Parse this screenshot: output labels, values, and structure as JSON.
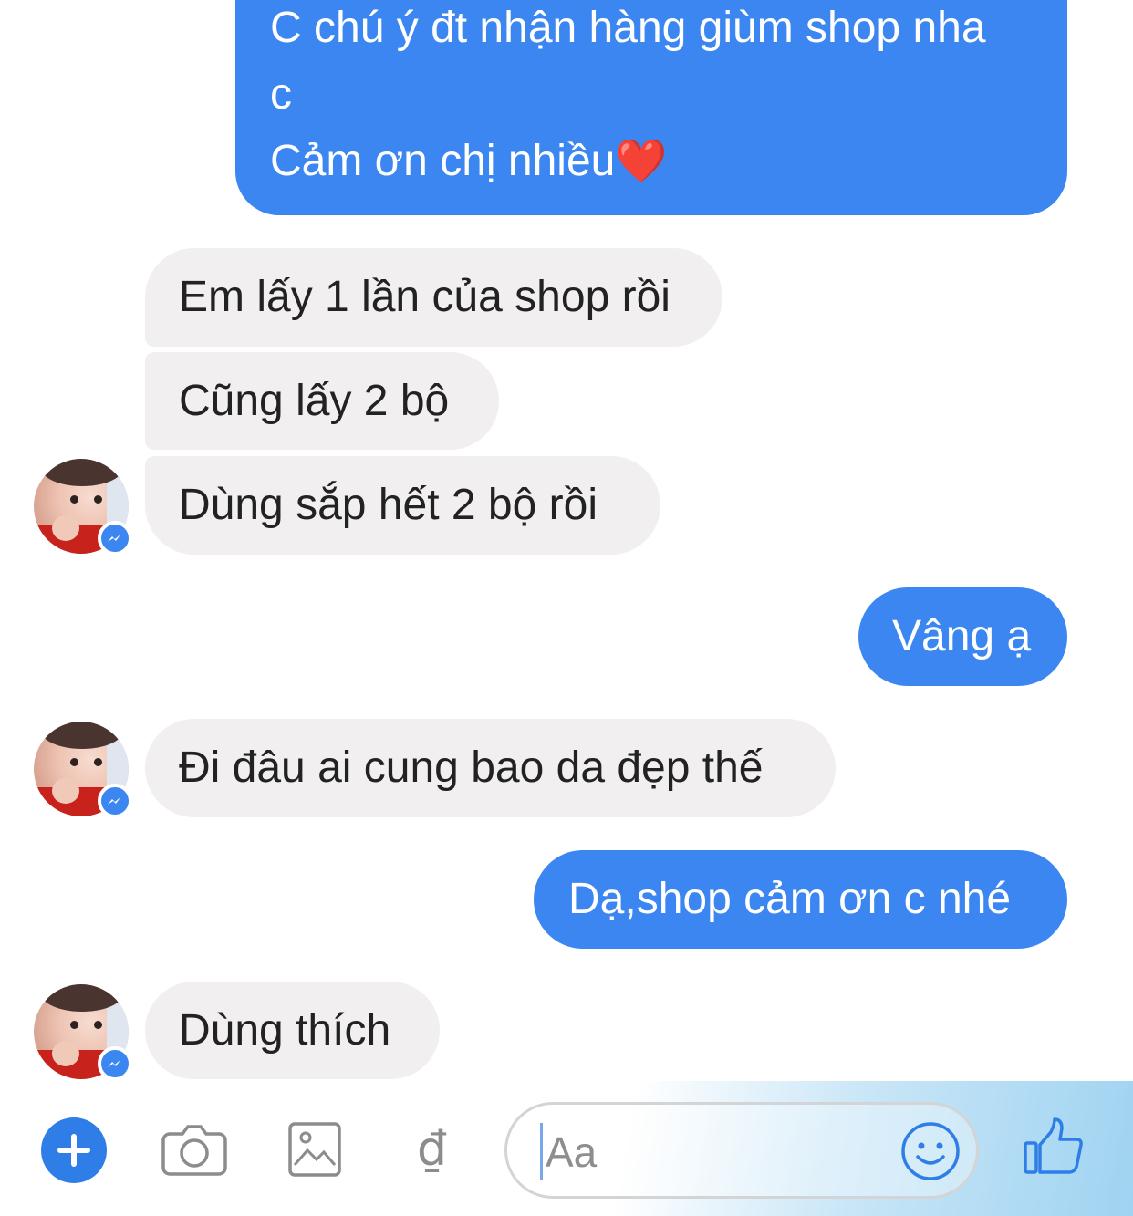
{
  "conversation": {
    "messages": [
      {
        "id": "m1",
        "direction": "out",
        "lines": [
          "C chú ý đt nhận hàng giùm shop nha",
          "c",
          "Cảm ơn chị nhiều"
        ],
        "emoji": "❤️"
      },
      {
        "id": "m2",
        "direction": "in",
        "text": "Em lấy 1 lần của shop rồi"
      },
      {
        "id": "m3",
        "direction": "in",
        "text": "Cũng lấy 2 bộ"
      },
      {
        "id": "m4",
        "direction": "in",
        "text": "Dùng sắp hết 2 bộ rồi"
      },
      {
        "id": "m5",
        "direction": "out",
        "text": "Vâng ạ"
      },
      {
        "id": "m6",
        "direction": "in",
        "text": "Đi đâu ai cung bao da đẹp thế"
      },
      {
        "id": "m7",
        "direction": "out",
        "text": "Dạ,shop cảm ơn c nhé"
      },
      {
        "id": "m8",
        "direction": "in",
        "text": "Dùng thích"
      }
    ]
  },
  "composer": {
    "input_placeholder": "Aa",
    "input_value": "",
    "payment_symbol": "₫",
    "icons": [
      "plus-icon",
      "camera-icon",
      "image-icon",
      "payment-icon",
      "emoji-icon",
      "thumbs-up-icon"
    ]
  },
  "colors": {
    "outgoing_bubble": "#3b86f0",
    "incoming_bubble": "#f1eff0",
    "accent": "#2f7ee8"
  }
}
